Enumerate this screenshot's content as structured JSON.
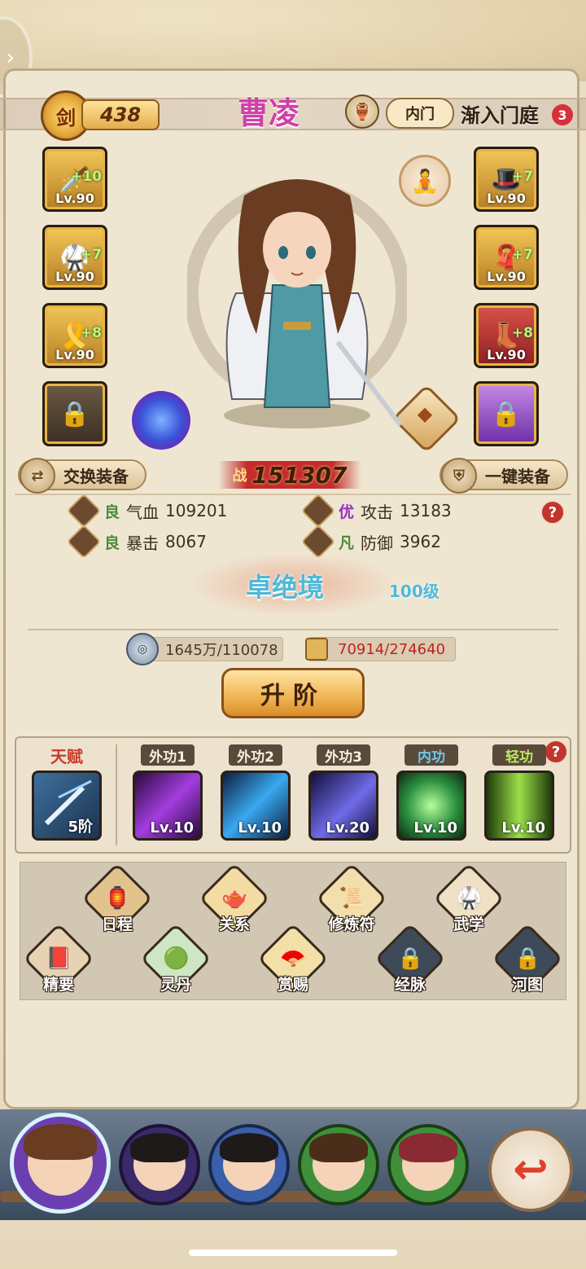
{
  "header": {
    "sword_glyph": "剑",
    "sword_level": "438",
    "hero_name": "曹凌",
    "sect_badge": "内门",
    "sect_status": "渐入门庭",
    "notice_count": "3"
  },
  "equipment_left": [
    {
      "icon": "sword-icon",
      "plus": "+10",
      "level": "Lv.90"
    },
    {
      "icon": "armor-icon",
      "plus": "+7",
      "level": "Lv.90"
    },
    {
      "icon": "belt-icon",
      "plus": "+8",
      "level": "Lv.90"
    }
  ],
  "equipment_right": [
    {
      "icon": "hat-icon",
      "plus": "+7",
      "level": "Lv.90"
    },
    {
      "icon": "bracer-icon",
      "plus": "+7",
      "level": "Lv.90"
    },
    {
      "icon": "boots-icon",
      "plus": "+8",
      "level": "Lv.90"
    }
  ],
  "buttons": {
    "swap_equipment": "交换装备",
    "auto_equip": "一键装备",
    "advance": "升阶"
  },
  "combat_power": {
    "prefix": "战",
    "value": "151307"
  },
  "stats": {
    "hp": {
      "grade": "良",
      "label": "气血",
      "value": "109201"
    },
    "attack": {
      "grade": "优",
      "label": "攻击",
      "value": "13183"
    },
    "crit": {
      "grade": "良",
      "label": "暴击",
      "value": "8067"
    },
    "defense": {
      "grade": "凡",
      "label": "防御",
      "value": "3962"
    }
  },
  "realm": {
    "name": "卓绝境",
    "level": "100级"
  },
  "costs": {
    "coins": "1645万/110078",
    "scrolls": "70914/274640"
  },
  "skills": [
    {
      "tag": "天赋",
      "level": "5阶",
      "type": "talent"
    },
    {
      "tag": "外功1",
      "level": "Lv.10",
      "type": "outer"
    },
    {
      "tag": "外功2",
      "level": "Lv.10",
      "type": "outer"
    },
    {
      "tag": "外功3",
      "level": "Lv.20",
      "type": "outer"
    },
    {
      "tag": "内功",
      "level": "Lv.10",
      "type": "inner"
    },
    {
      "tag": "轻功",
      "level": "Lv.10",
      "type": "light"
    }
  ],
  "features": {
    "schedule": "日程",
    "relations": "关系",
    "cultivation_talisman": "修炼符",
    "martial_arts": "武学",
    "essentials": "精要",
    "elixir": "灵丹",
    "rewards": "赏赐",
    "meridians": "经脉",
    "river_map": "河图"
  },
  "colors": {
    "name": "#d041a8",
    "realm": "#4fb9d8",
    "scroll_value": "#c3201e",
    "accent_gold": "#e7b546"
  }
}
